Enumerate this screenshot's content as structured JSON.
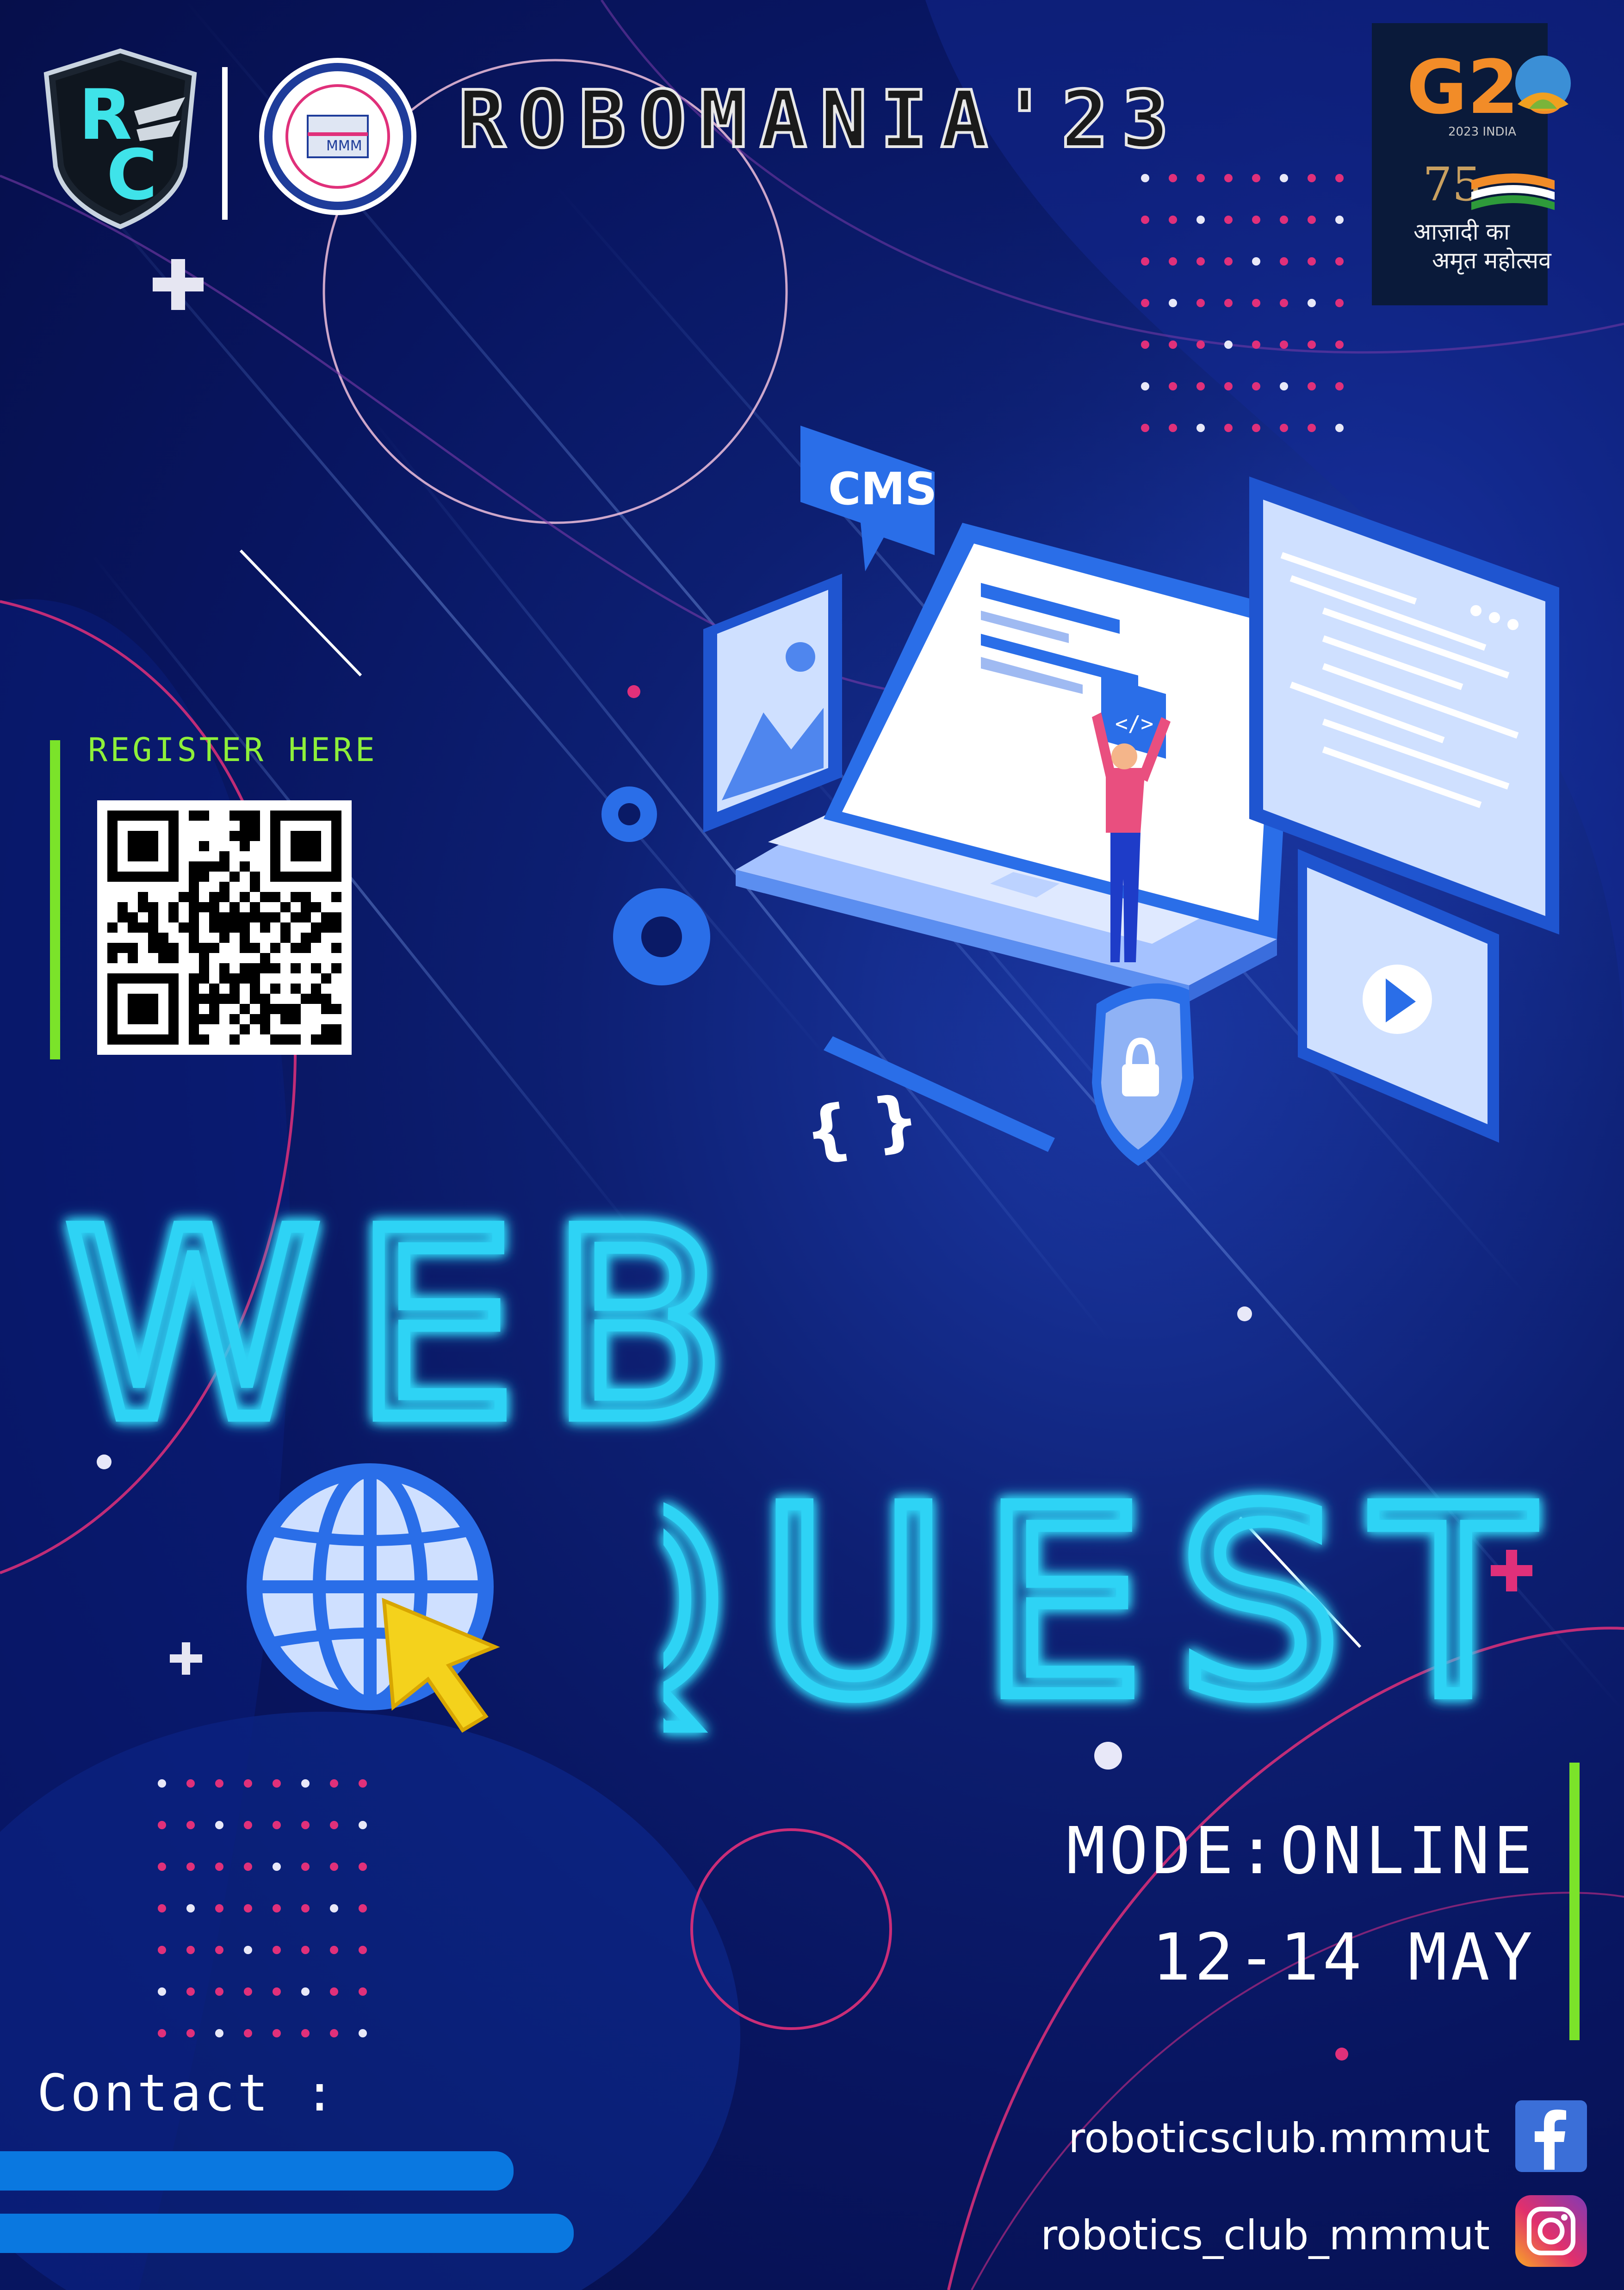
{
  "header": {
    "event_title": "ROBOMANIA'23",
    "g20_label": "G20",
    "g20_subtitle": "2023 INDIA",
    "azadi_line1": "आज़ादी का",
    "azadi_line2": "अमृत महोत्सव",
    "azadi_number": "75"
  },
  "register": {
    "label": "REGISTER HERE"
  },
  "illustration": {
    "cms_label": "CMS",
    "code_label": "</>"
  },
  "event": {
    "name_line1": "WEB",
    "name_line2": "QUEST",
    "mode": "MODE:ONLINE",
    "dates": "12-14 MAY"
  },
  "contact": {
    "label": "Contact :"
  },
  "social": {
    "facebook_handle": "roboticsclub.mmmut",
    "instagram_handle": "robotics_club_mmmut",
    "icons": [
      "facebook-icon",
      "instagram-icon"
    ]
  },
  "colors": {
    "background": "#0a1a66",
    "accent_cyan": "#2fd3f5",
    "accent_green": "#7be32a",
    "accent_pink": "#e0307a",
    "facebook": "#3b6fd8",
    "instagram": "#e1306c"
  }
}
